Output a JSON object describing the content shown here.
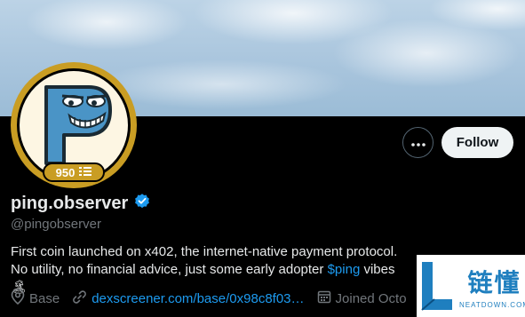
{
  "profile": {
    "display_name": "ping.observer",
    "handle": "@pingobserver",
    "badge_count": "950",
    "bio_text": "First coin launched on x402, the internet-native payment protocol. No utility, no financial advice, just some early adopter ",
    "bio_cashtag": "$ping",
    "bio_suffix": " vibes",
    "bio_emoji": "🏝",
    "location": "Base",
    "website": "dexscreener.com/base/0x98c8f03…",
    "joined": "Joined Octo"
  },
  "actions": {
    "more_label": "•••",
    "follow_label": "Follow"
  },
  "watermark": {
    "brand_cn": "链懂",
    "brand_en": "NEATDOWN.COM"
  },
  "colors": {
    "accent": "#1d9bf0",
    "ring_gold": "#c99d23",
    "avatar_blue": "#4a94c6"
  }
}
